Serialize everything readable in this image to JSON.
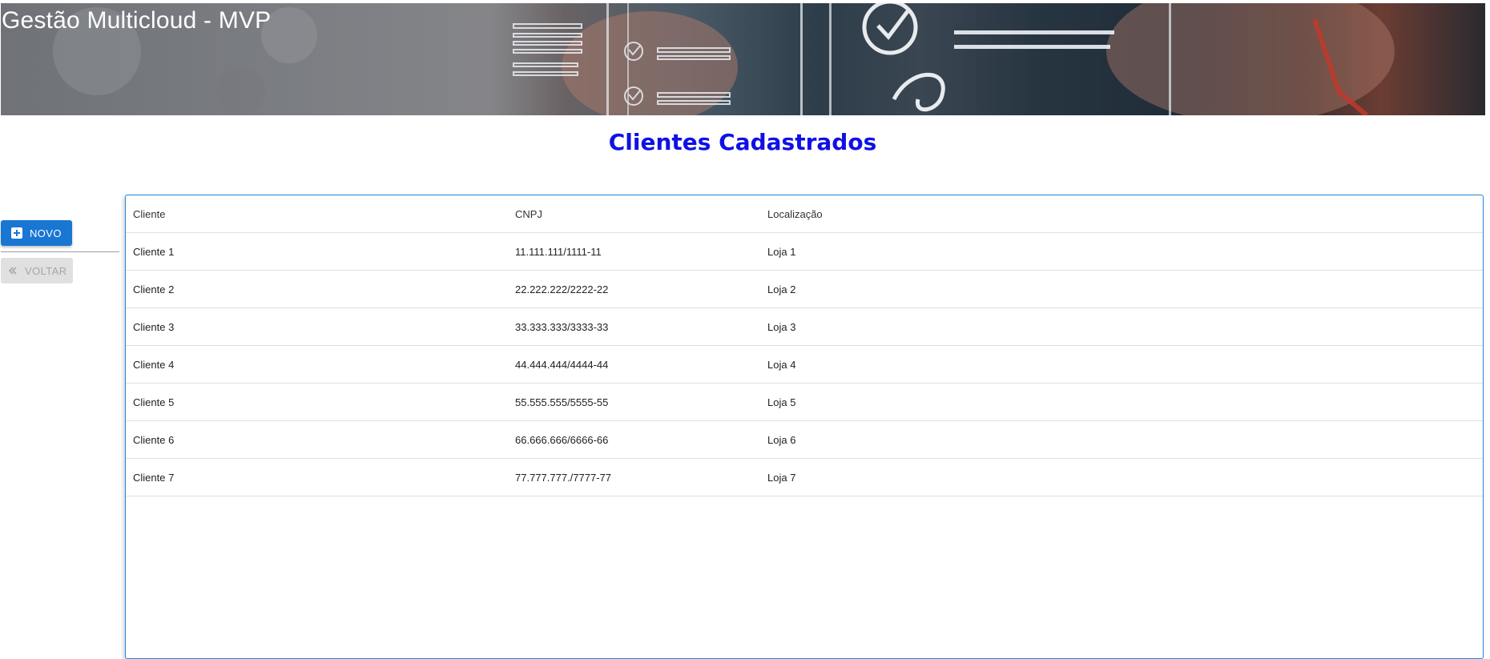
{
  "header": {
    "app_title": "Gestão Multicloud - MVP"
  },
  "page": {
    "title": "Clientes Cadastrados"
  },
  "actions": {
    "novo_label": "NOVO",
    "voltar_label": "VOLTAR"
  },
  "icons": {
    "novo": "plus-box-icon",
    "voltar": "double-chevron-left-icon"
  },
  "colors": {
    "title": "#1010e6",
    "primary_button": "#1976d2",
    "disabled_button": "#e0e0e0",
    "table_border": "#1e88e5"
  },
  "table": {
    "columns": [
      "Cliente",
      "CNPJ",
      "Localização"
    ],
    "rows": [
      {
        "cliente": "Cliente 1",
        "cnpj": "11.111.111/1111-11",
        "localizacao": "Loja 1"
      },
      {
        "cliente": "Cliente 2",
        "cnpj": "22.222.222/2222-22",
        "localizacao": "Loja 2"
      },
      {
        "cliente": "Cliente 3",
        "cnpj": "33.333.333/3333-33",
        "localizacao": "Loja 3"
      },
      {
        "cliente": "Cliente 4",
        "cnpj": "44.444.444/4444-44",
        "localizacao": "Loja 4"
      },
      {
        "cliente": "Cliente 5",
        "cnpj": "55.555.555/5555-55",
        "localizacao": "Loja 5"
      },
      {
        "cliente": "Cliente 6",
        "cnpj": "66.666.666/6666-66",
        "localizacao": "Loja 6"
      },
      {
        "cliente": "Cliente 7",
        "cnpj": "77.777.777./7777-77",
        "localizacao": "Loja 7"
      }
    ]
  }
}
